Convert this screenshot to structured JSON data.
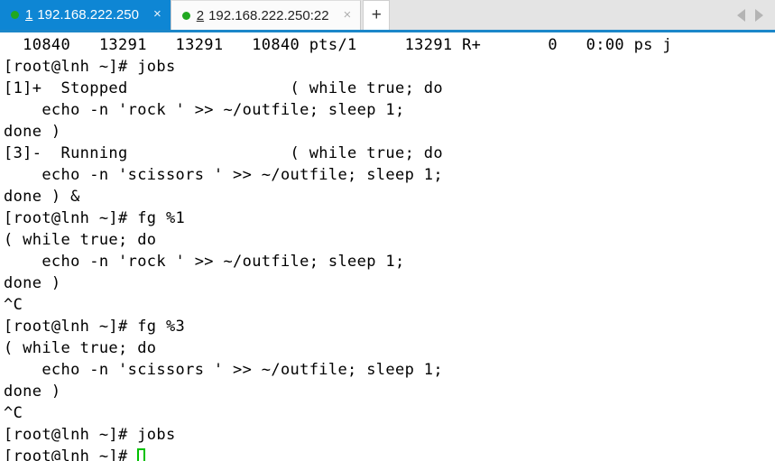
{
  "tabbar": {
    "tabs": [
      {
        "index": "1",
        "title": "192.168.222.250",
        "status_icon": "green-dot-icon",
        "close_label": "×",
        "active": true
      },
      {
        "index": "2",
        "title": "192.168.222.250:22",
        "status_icon": "green-dot-icon",
        "close_label": "×",
        "active": false
      }
    ],
    "new_tab_label": "+",
    "nav_prev_icon": "triangle-left-icon",
    "nav_next_icon": "triangle-right-icon",
    "accent_color": "#0e86d4",
    "underline_color": "#1b87c9",
    "status_dot_color": "#21a821"
  },
  "terminal": {
    "background_color": "#ffffff",
    "foreground_color": "#000000",
    "cursor_color": "#00c000",
    "prompt": "[root@lnh ~]#",
    "lines": [
      "  10840   13291   13291   10840 pts/1     13291 R+       0   0:00 ps j",
      "[root@lnh ~]# jobs",
      "[1]+  Stopped                 ( while true; do",
      "    echo -n 'rock ' >> ~/outfile; sleep 1;",
      "done )",
      "[3]-  Running                 ( while true; do",
      "    echo -n 'scissors ' >> ~/outfile; sleep 1;",
      "done ) &",
      "[root@lnh ~]# fg %1",
      "( while true; do",
      "    echo -n 'rock ' >> ~/outfile; sleep 1;",
      "done )",
      "^C",
      "[root@lnh ~]# fg %3",
      "( while true; do",
      "    echo -n 'scissors ' >> ~/outfile; sleep 1;",
      "done )",
      "^C",
      "[root@lnh ~]# jobs",
      "[root@lnh ~]# "
    ],
    "cursor_line_index": 19
  }
}
